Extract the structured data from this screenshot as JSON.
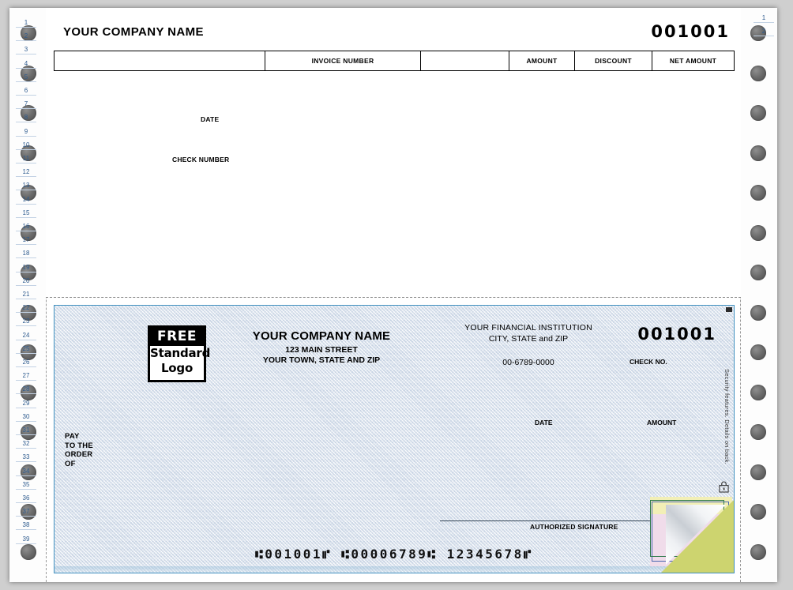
{
  "document": {
    "type": "continuous-feed-business-check",
    "colors": {
      "check_border": "#3f8fbf",
      "security_bg": "#e3eaf3",
      "line_number": "#2f5c8f",
      "copy_yellow": "#f2efb6",
      "copy_pink": "#f0dcea"
    }
  },
  "stub": {
    "company_name": "YOUR COMPANY NAME",
    "check_number": "001001",
    "table_headers": [
      "",
      "INVOICE NUMBER",
      "",
      "AMOUNT",
      "DISCOUNT",
      "NET AMOUNT"
    ],
    "date_label": "DATE",
    "check_number_label": "CHECK NUMBER"
  },
  "check": {
    "logo": {
      "free": "FREE",
      "standard": "Standard",
      "logo": "Logo"
    },
    "payer": {
      "name": "YOUR COMPANY NAME",
      "address_line1": "123 MAIN STREET",
      "address_line2": "YOUR TOWN, STATE AND ZIP"
    },
    "bank": {
      "name": "YOUR FINANCIAL INSTITUTION",
      "city_state_zip": "CITY, STATE and ZIP",
      "fraction": "00-6789-0000"
    },
    "check_no_label": "CHECK NO.",
    "check_number": "001001",
    "date_label": "DATE",
    "amount_label": "AMOUNT",
    "pay_to": {
      "line1": "PAY",
      "line2": "TO THE",
      "line3": "ORDER",
      "line4": "OF"
    },
    "signature_label": "AUTHORIZED SIGNATURE",
    "security_notice": "Security features. Details on back.",
    "lock_icon": "padlock-icon",
    "micr_line": "⑆001001⑈ ⑆00006789⑆ 12345678⑈",
    "micr_parts": {
      "check_number": "001001",
      "routing": "00006789",
      "account": "12345678"
    }
  },
  "feed": {
    "left_line_numbers": [
      "1",
      "2",
      "3",
      "4",
      "5",
      "6",
      "7",
      "8",
      "9",
      "10",
      "11",
      "12",
      "13",
      "14",
      "15",
      "16",
      "17",
      "18",
      "19",
      "20",
      "21",
      "22",
      "23",
      "24",
      "25",
      "26",
      "27",
      "28",
      "29",
      "30",
      "31",
      "32",
      "33",
      "34",
      "35",
      "36",
      "37",
      "38",
      "39"
    ],
    "right_line_numbers": [
      "1",
      "2"
    ]
  }
}
